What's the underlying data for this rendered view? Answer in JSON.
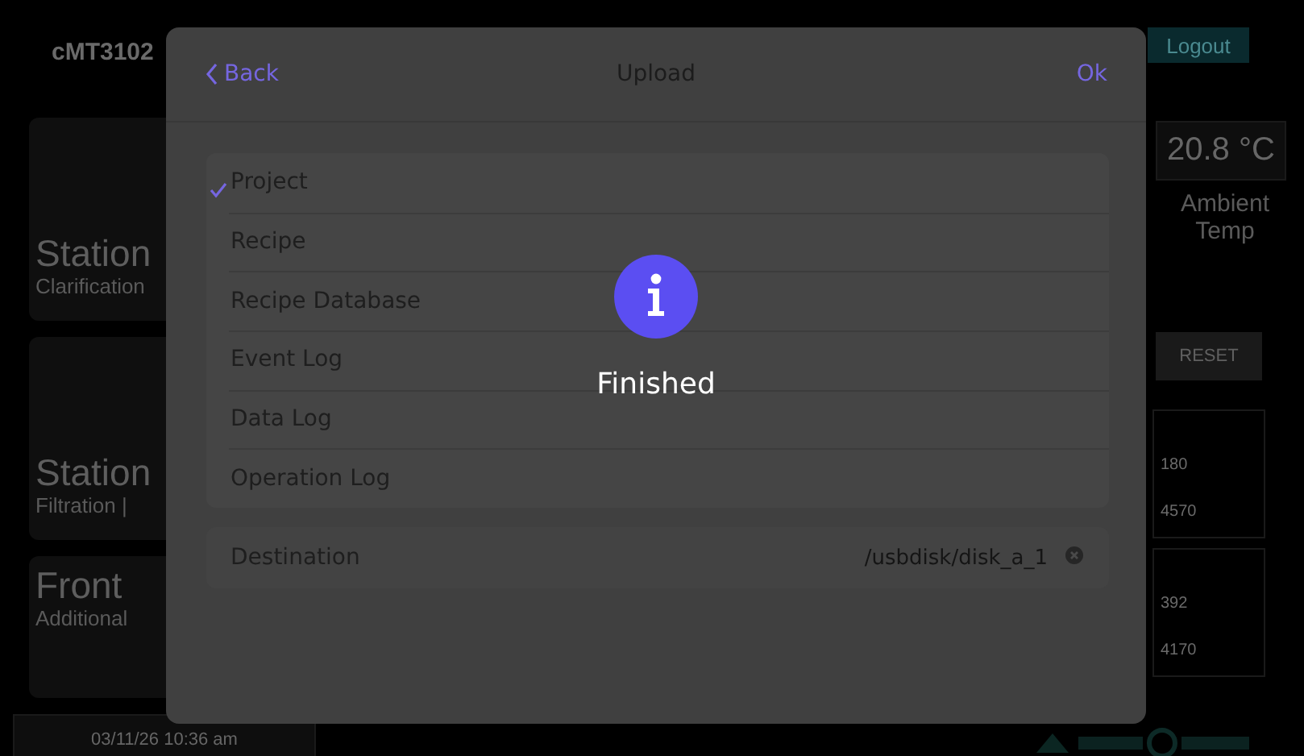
{
  "background": {
    "device": "cMT3102",
    "logout": "Logout",
    "cards": [
      {
        "title": "Station",
        "subtitle": "Clarification"
      },
      {
        "title": "Station",
        "subtitle": "Filtration |"
      },
      {
        "title": "Front",
        "subtitle": "Additional"
      }
    ],
    "timestamp": "03/11/26 10:36 am",
    "temperature": "20.8 °C",
    "temperature_label": "Ambient Temp",
    "reset": "RESET",
    "panels": [
      {
        "values": [
          "180",
          "4570"
        ]
      },
      {
        "values": [
          "392",
          "4170"
        ]
      }
    ]
  },
  "dialog": {
    "title": "Upload",
    "back": "Back",
    "ok": "Ok",
    "items": [
      {
        "label": "Project",
        "checked": true
      },
      {
        "label": "Recipe",
        "checked": false
      },
      {
        "label": "Recipe Database",
        "checked": false
      },
      {
        "label": "Event Log",
        "checked": false
      },
      {
        "label": "Data Log",
        "checked": false
      },
      {
        "label": "Operation Log",
        "checked": false
      }
    ],
    "destination": {
      "label": "Destination",
      "value": "/usbdisk/disk_a_1"
    },
    "message": "Finished"
  }
}
